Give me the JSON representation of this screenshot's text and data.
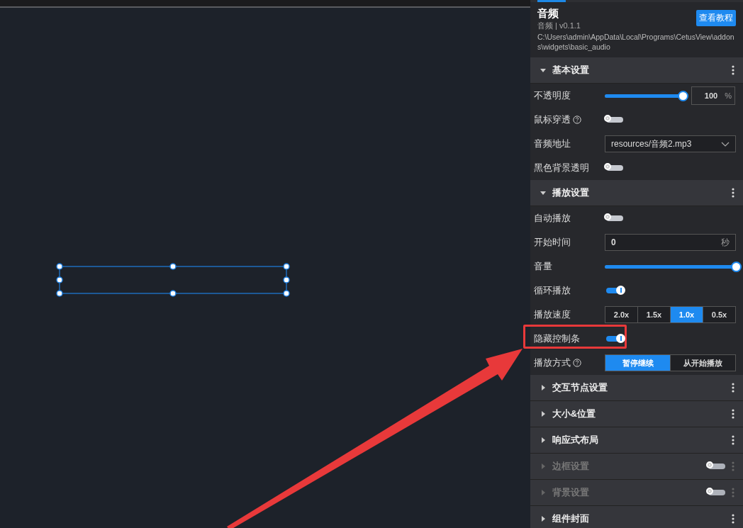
{
  "canvas": {
    "selection": {
      "selected": true
    }
  },
  "component": {
    "title": "音频",
    "subtitle": "音频 | v0.1.1",
    "path": "C:\\Users\\admin\\AppData\\Local\\Programs\\CetusView\\addons\\widgets\\basic_audio",
    "button": "查看教程"
  },
  "sections": [
    {
      "title": "基本设置",
      "expanded": true,
      "rows": [
        {
          "kind": "slider-input",
          "label": "不透明度",
          "level": 1,
          "value": "100",
          "unit": "%"
        },
        {
          "kind": "toggle",
          "label": "鼠标穿透",
          "help": true,
          "on": false
        },
        {
          "kind": "select",
          "label": "音频地址",
          "value": "resources/音频2.mp3"
        },
        {
          "kind": "toggle",
          "label": "黑色背景透明",
          "on": false
        }
      ]
    },
    {
      "title": "播放设置",
      "expanded": true,
      "rows": [
        {
          "kind": "toggle",
          "label": "自动播放",
          "on": false
        },
        {
          "kind": "input",
          "label": "开始时间",
          "value": "0",
          "unit": "秒"
        },
        {
          "kind": "slider",
          "label": "音量",
          "level": 1
        },
        {
          "kind": "toggle",
          "label": "循环播放",
          "on": true
        },
        {
          "kind": "segmented",
          "label": "播放速度",
          "options": [
            {
              "label": "2.0x",
              "selected": false
            },
            {
              "label": "1.5x",
              "selected": false
            },
            {
              "label": "1.0x",
              "selected": true
            },
            {
              "label": "0.5x",
              "selected": false
            }
          ]
        },
        {
          "kind": "toggle",
          "label": "隐藏控制条",
          "on": true,
          "highlighted": true
        },
        {
          "kind": "segmented",
          "label": "播放方式",
          "help": true,
          "options": [
            {
              "label": "暂停继续",
              "selected": true
            },
            {
              "label": "从开始播放",
              "selected": false
            }
          ]
        }
      ]
    },
    {
      "title": "交互节点设置",
      "expanded": false
    },
    {
      "title": "大小&位置",
      "expanded": false
    },
    {
      "title": "响应式布局",
      "expanded": false
    },
    {
      "title": "边框设置",
      "expanded": false,
      "disabled": true,
      "toggle": {
        "on": false
      }
    },
    {
      "title": "背景设置",
      "expanded": false,
      "disabled": true,
      "toggle": {
        "on": false
      }
    },
    {
      "title": "组件封面",
      "expanded": false
    }
  ]
}
